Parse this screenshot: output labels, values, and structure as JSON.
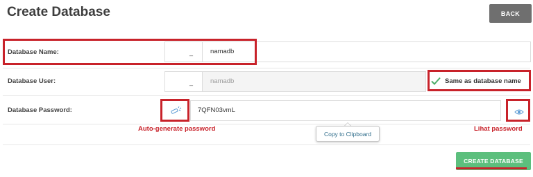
{
  "header": {
    "title": "Create Database",
    "back_label": "BACK"
  },
  "form": {
    "db_name": {
      "label": "Database Name:",
      "prefix": "_",
      "value": "namadb"
    },
    "db_user": {
      "label": "Database User:",
      "prefix": "_",
      "value": "namadb",
      "same_as_label": "Same as database name",
      "same_as_checked": true
    },
    "db_password": {
      "label": "Database Password:",
      "value": "7QFN03vmL",
      "tooltip": "Copy to Clipboard"
    }
  },
  "annotations": {
    "autogen": "Auto-generate password",
    "show_password": "Lihat password",
    "color": "#c8222a"
  },
  "actions": {
    "create_label": "CREATE DATABASE",
    "create_color": "#5cbf7d"
  },
  "icons": {
    "generate": "magic-wand-icon",
    "show": "eye-icon",
    "check": "checkmark-icon"
  }
}
